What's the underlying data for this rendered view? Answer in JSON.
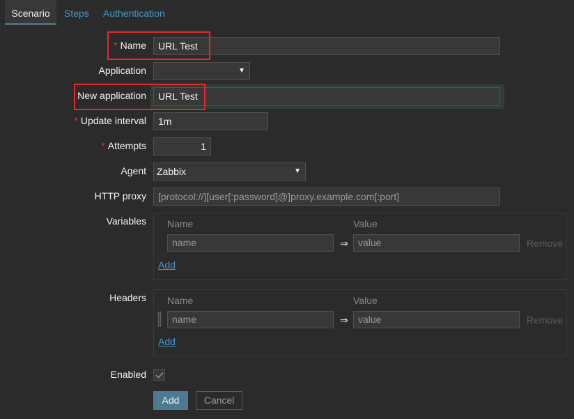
{
  "tabs": [
    {
      "label": "Scenario",
      "active": true
    },
    {
      "label": "Steps",
      "active": false
    },
    {
      "label": "Authentication",
      "active": false
    }
  ],
  "form": {
    "name": {
      "label": "Name",
      "required": true,
      "value": "URL Test"
    },
    "application": {
      "label": "Application",
      "value": ""
    },
    "new_application": {
      "label": "New application",
      "value": "URL Test"
    },
    "update_interval": {
      "label": "Update interval",
      "required": true,
      "value": "1m"
    },
    "attempts": {
      "label": "Attempts",
      "required": true,
      "value": "1"
    },
    "agent": {
      "label": "Agent",
      "value": "Zabbix"
    },
    "http_proxy": {
      "label": "HTTP proxy",
      "placeholder": "[protocol://][user[:password]@]proxy.example.com[:port]"
    },
    "variables": {
      "label": "Variables",
      "col_name": "Name",
      "col_value": "Value",
      "rows": [
        {
          "name_placeholder": "name",
          "value_placeholder": "value",
          "remove_label": "Remove"
        }
      ],
      "add_label": "Add"
    },
    "headers": {
      "label": "Headers",
      "col_name": "Name",
      "col_value": "Value",
      "rows": [
        {
          "name_placeholder": "name",
          "value_placeholder": "value",
          "remove_label": "Remove"
        }
      ],
      "add_label": "Add"
    },
    "enabled": {
      "label": "Enabled",
      "checked": true
    },
    "arrow_symbol": "⇒",
    "select_arrow": "▼"
  },
  "buttons": {
    "add_label": "Add",
    "cancel_label": "Cancel"
  },
  "colors": {
    "background": "#2b2b2b",
    "link": "#4796c4",
    "required": "#e33734",
    "highlight_box": "#e8262b",
    "primary_button": "#4d7a92"
  }
}
